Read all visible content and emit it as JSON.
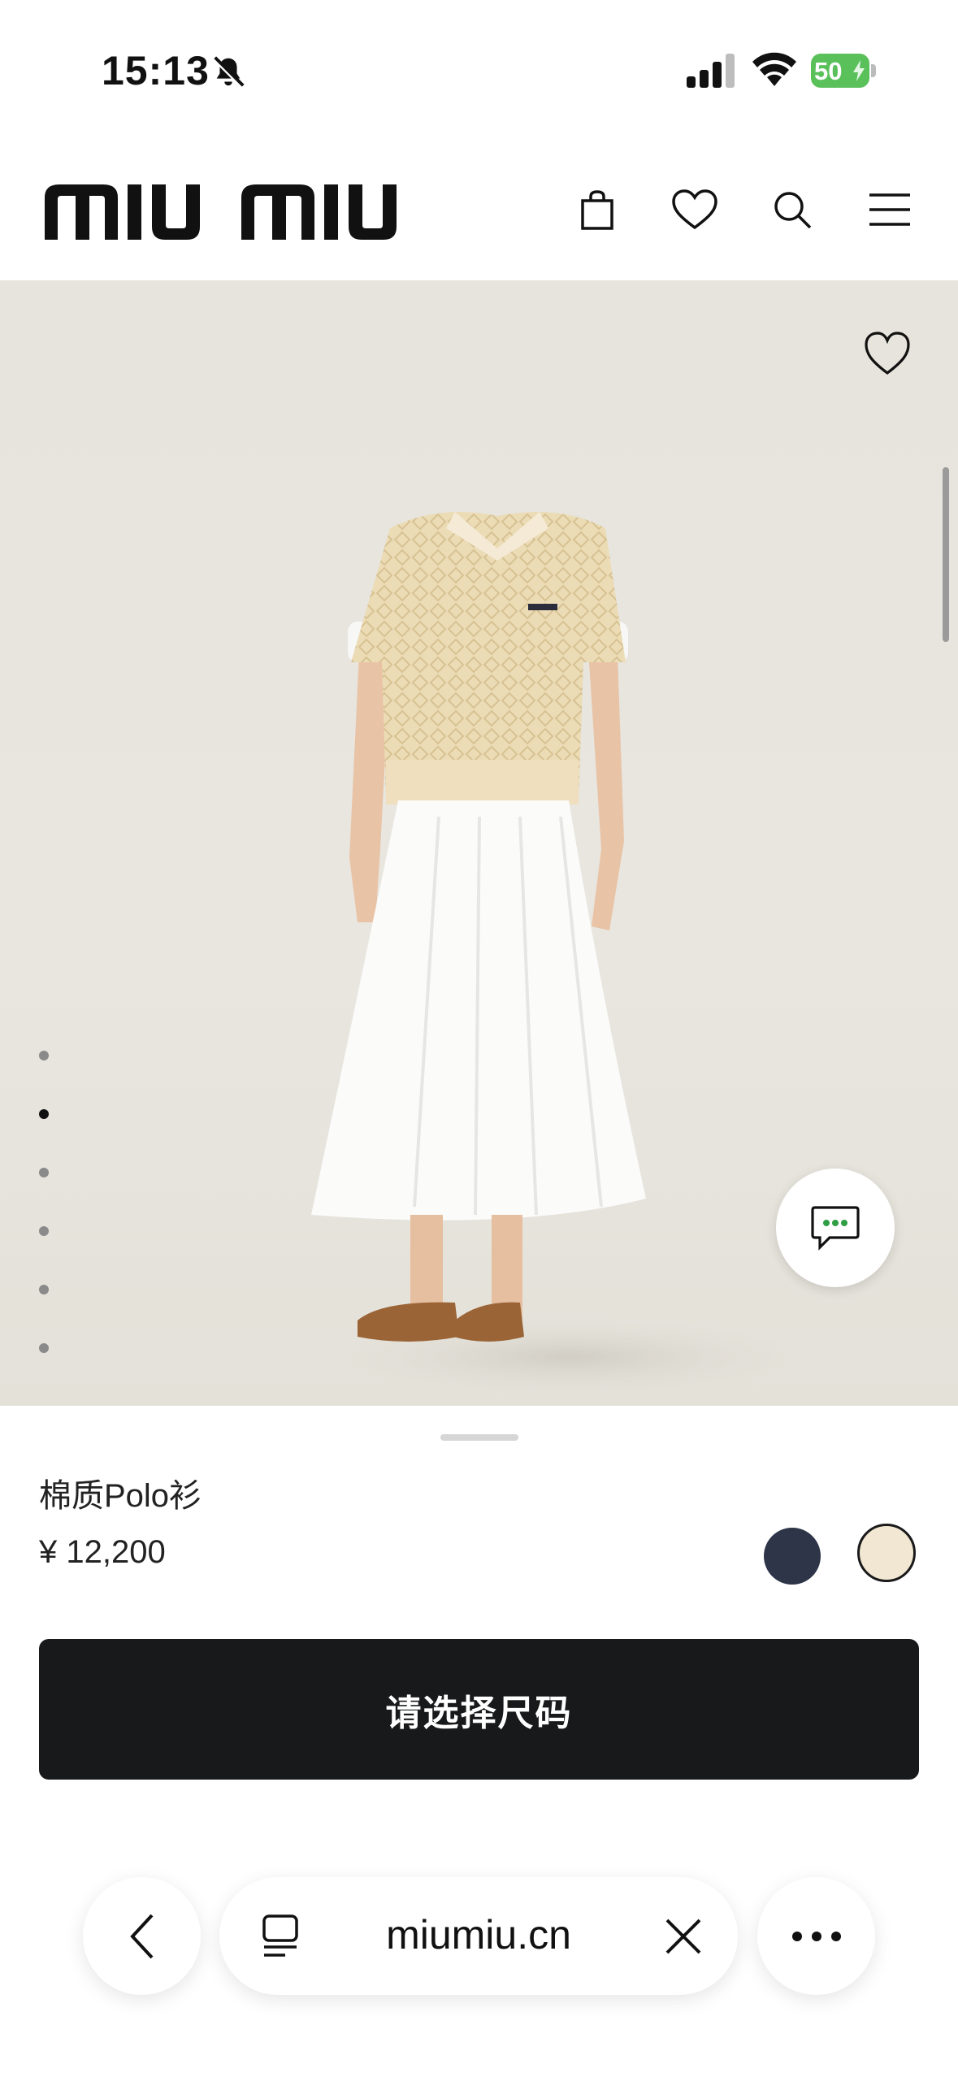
{
  "status_bar": {
    "time": "15:13",
    "battery_percent": "50",
    "icons": [
      "bell-slash-icon",
      "cellular-signal-icon",
      "wifi-icon",
      "battery-charging-icon"
    ]
  },
  "header": {
    "brand": "miu miu",
    "icons": [
      "shopping-bag-icon",
      "heart-icon",
      "search-icon",
      "menu-icon"
    ]
  },
  "gallery": {
    "dot_count": 6,
    "active_index": 1
  },
  "product": {
    "name": "棉质Polo衫",
    "price": "¥ 12,200",
    "colors": [
      {
        "name": "navy",
        "hex": "#2e3549",
        "selected": false
      },
      {
        "name": "cream",
        "hex": "#f2e7d2",
        "selected": true
      }
    ],
    "cta_label": "请选择尺码"
  },
  "browser": {
    "url": "miumiu.cn"
  }
}
